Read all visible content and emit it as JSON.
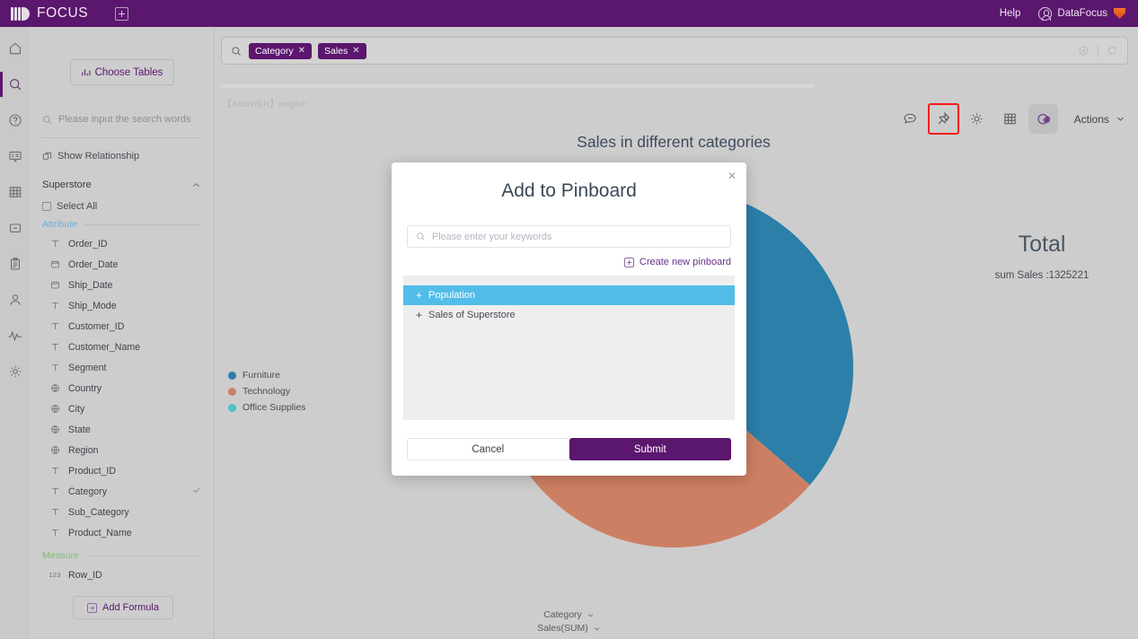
{
  "topbar": {
    "brand": "FOCUS",
    "add_icon": "plus-square-icon",
    "help_label": "Help",
    "user_label": "DataFocus"
  },
  "rail": {
    "items": [
      {
        "name": "home",
        "icon": "home-icon",
        "active": false
      },
      {
        "name": "search",
        "icon": "search-icon",
        "active": true
      },
      {
        "name": "help",
        "icon": "question-circle-icon",
        "active": false
      },
      {
        "name": "board",
        "icon": "monitor-icon",
        "active": false
      },
      {
        "name": "tables",
        "icon": "grid-icon",
        "active": false
      },
      {
        "name": "collapse",
        "icon": "minus-box-icon",
        "active": false
      },
      {
        "name": "tasks",
        "icon": "clipboard-icon",
        "active": false
      },
      {
        "name": "users",
        "icon": "user-icon",
        "active": false
      },
      {
        "name": "monitor",
        "icon": "pulse-icon",
        "active": false
      },
      {
        "name": "settings",
        "icon": "gear-icon",
        "active": false
      }
    ]
  },
  "sidebar": {
    "choose_tables_label": "Choose Tables",
    "search_placeholder": "Please input the search words",
    "show_relationship_label": "Show Relationship",
    "table_name": "Superstore",
    "select_all_label": "Select All",
    "attribute_label": "Attribute",
    "measure_label": "Measure",
    "add_formula_label": "Add Formula",
    "attributes": [
      {
        "label": "Order_ID",
        "type": "text",
        "checked": false
      },
      {
        "label": "Order_Date",
        "type": "date",
        "checked": false
      },
      {
        "label": "Ship_Date",
        "type": "date",
        "checked": false
      },
      {
        "label": "Ship_Mode",
        "type": "text",
        "checked": false
      },
      {
        "label": "Customer_ID",
        "type": "text",
        "checked": false
      },
      {
        "label": "Customer_Name",
        "type": "text",
        "checked": false
      },
      {
        "label": "Segment",
        "type": "text",
        "checked": false
      },
      {
        "label": "Country",
        "type": "geo",
        "checked": false
      },
      {
        "label": "City",
        "type": "geo",
        "checked": false
      },
      {
        "label": "State",
        "type": "geo",
        "checked": false
      },
      {
        "label": "Region",
        "type": "geo",
        "checked": false
      },
      {
        "label": "Product_ID",
        "type": "text",
        "checked": false
      },
      {
        "label": "Category",
        "type": "text",
        "checked": true
      },
      {
        "label": "Sub_Category",
        "type": "text",
        "checked": false
      },
      {
        "label": "Product_Name",
        "type": "text",
        "checked": false
      }
    ],
    "measures": [
      {
        "label": "Row_ID",
        "type": "number",
        "checked": false
      }
    ]
  },
  "search": {
    "chips": [
      {
        "label": "Category"
      },
      {
        "label": "Sales"
      }
    ],
    "clear_icon": "clear-circle-icon",
    "refresh_icon": "refresh-icon",
    "answer_tag": "【ANSWER】english"
  },
  "toolbar": {
    "tools": [
      {
        "name": "comment",
        "icon": "chat-icon",
        "active": false,
        "flagged": false
      },
      {
        "name": "pin",
        "icon": "pin-icon",
        "active": false,
        "flagged": true
      },
      {
        "name": "settings",
        "icon": "gear-icon",
        "active": false,
        "flagged": false
      },
      {
        "name": "table",
        "icon": "table-icon",
        "active": false,
        "flagged": false
      },
      {
        "name": "chart",
        "icon": "pie-chart-icon",
        "active": true,
        "flagged": false
      }
    ],
    "actions_label": "Actions"
  },
  "chart_data": {
    "type": "pie",
    "title": "Sales in different categories",
    "categories": [
      "Furniture",
      "Technology",
      "Office Supplies"
    ],
    "values": [
      481000,
      441000,
      403221
    ],
    "colors": [
      "#2b7fa8",
      "#cd7f63",
      "#4cc2c5"
    ],
    "legend_position": "left",
    "xlabel": "Category",
    "ylabel": "Sales(SUM)",
    "total_label": "Total",
    "total_value": "sum Sales :1325221",
    "axis_picks": [
      "Category",
      "Sales(SUM)"
    ]
  },
  "modal": {
    "title": "Add to Pinboard",
    "close_icon": "close-icon",
    "search_placeholder": "Please enter your keywords",
    "create_label": "Create new pinboard",
    "items": [
      {
        "label": "Population",
        "selected": true
      },
      {
        "label": "Sales of Superstore",
        "selected": false
      }
    ],
    "cancel_label": "Cancel",
    "submit_label": "Submit"
  }
}
